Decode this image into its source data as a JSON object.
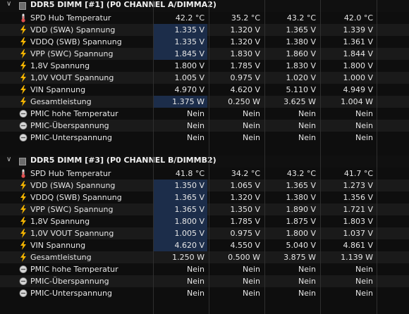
{
  "groups": [
    {
      "title": "DDR5 DIMM [#1] (P0 CHANNEL A/DIMMA2)",
      "rows": [
        {
          "icon": "thermometer-icon",
          "label": "SPD Hub Temperatur",
          "values": [
            "42.2 °C",
            "35.2 °C",
            "43.2 °C",
            "42.0 °C"
          ],
          "hl": false
        },
        {
          "icon": "lightning-icon",
          "label": "VDD (SWA) Spannung",
          "values": [
            "1.335 V",
            "1.320 V",
            "1.365 V",
            "1.339 V"
          ],
          "hl": true
        },
        {
          "icon": "lightning-icon",
          "label": "VDDQ (SWB) Spannung",
          "values": [
            "1.335 V",
            "1.320 V",
            "1.380 V",
            "1.361 V"
          ],
          "hl": true
        },
        {
          "icon": "lightning-icon",
          "label": "VPP (SWC) Spannung",
          "values": [
            "1.845 V",
            "1.830 V",
            "1.860 V",
            "1.844 V"
          ],
          "hl": true
        },
        {
          "icon": "lightning-icon",
          "label": "1,8V Spannung",
          "values": [
            "1.800 V",
            "1.785 V",
            "1.830 V",
            "1.800 V"
          ],
          "hl": false
        },
        {
          "icon": "lightning-icon",
          "label": "1,0V VOUT Spannung",
          "values": [
            "1.005 V",
            "0.975 V",
            "1.020 V",
            "1.000 V"
          ],
          "hl": false
        },
        {
          "icon": "lightning-icon",
          "label": "VIN Spannung",
          "values": [
            "4.970 V",
            "4.620 V",
            "5.110 V",
            "4.949 V"
          ],
          "hl": false
        },
        {
          "icon": "lightning-icon",
          "label": "Gesamtleistung",
          "values": [
            "1.375 W",
            "0.250 W",
            "3.625 W",
            "1.004 W"
          ],
          "hl": true
        },
        {
          "icon": "circle-dash-icon",
          "label": "PMIC hohe Temperatur",
          "values": [
            "Nein",
            "Nein",
            "Nein",
            "Nein"
          ],
          "hl": false
        },
        {
          "icon": "circle-dash-icon",
          "label": "PMIC-Überspannung",
          "values": [
            "Nein",
            "Nein",
            "Nein",
            "Nein"
          ],
          "hl": false
        },
        {
          "icon": "circle-dash-icon",
          "label": "PMIC-Unterspannung",
          "values": [
            "Nein",
            "Nein",
            "Nein",
            "Nein"
          ],
          "hl": false
        }
      ]
    },
    {
      "title": "DDR5 DIMM [#3] (P0 CHANNEL B/DIMMB2)",
      "rows": [
        {
          "icon": "thermometer-icon",
          "label": "SPD Hub Temperatur",
          "values": [
            "41.8 °C",
            "34.2 °C",
            "43.2 °C",
            "41.7 °C"
          ],
          "hl": false
        },
        {
          "icon": "lightning-icon",
          "label": "VDD (SWA) Spannung",
          "values": [
            "1.350 V",
            "1.065 V",
            "1.365 V",
            "1.273 V"
          ],
          "hl": true
        },
        {
          "icon": "lightning-icon",
          "label": "VDDQ (SWB) Spannung",
          "values": [
            "1.365 V",
            "1.320 V",
            "1.380 V",
            "1.356 V"
          ],
          "hl": true
        },
        {
          "icon": "lightning-icon",
          "label": "VPP (SWC) Spannung",
          "values": [
            "1.365 V",
            "1.350 V",
            "1.890 V",
            "1.721 V"
          ],
          "hl": true
        },
        {
          "icon": "lightning-icon",
          "label": "1,8V Spannung",
          "values": [
            "1.800 V",
            "1.785 V",
            "1.875 V",
            "1.803 V"
          ],
          "hl": true
        },
        {
          "icon": "lightning-icon",
          "label": "1,0V VOUT Spannung",
          "values": [
            "1.005 V",
            "0.975 V",
            "1.800 V",
            "1.037 V"
          ],
          "hl": true
        },
        {
          "icon": "lightning-icon",
          "label": "VIN Spannung",
          "values": [
            "4.620 V",
            "4.550 V",
            "5.040 V",
            "4.861 V"
          ],
          "hl": true
        },
        {
          "icon": "lightning-icon",
          "label": "Gesamtleistung",
          "values": [
            "1.250 W",
            "0.500 W",
            "3.875 W",
            "1.139 W"
          ],
          "hl": false
        },
        {
          "icon": "circle-dash-icon",
          "label": "PMIC hohe Temperatur",
          "values": [
            "Nein",
            "Nein",
            "Nein",
            "Nein"
          ],
          "hl": false
        },
        {
          "icon": "circle-dash-icon",
          "label": "PMIC-Überspannung",
          "values": [
            "Nein",
            "Nein",
            "Nein",
            "Nein"
          ],
          "hl": false
        },
        {
          "icon": "circle-dash-icon",
          "label": "PMIC-Unterspannung",
          "values": [
            "Nein",
            "Nein",
            "Nein",
            "Nein"
          ],
          "hl": false
        }
      ]
    }
  ],
  "colors": {
    "highlight": "#1c2d4a",
    "lightning": "#f4b400",
    "thermometer": "#e05050"
  }
}
